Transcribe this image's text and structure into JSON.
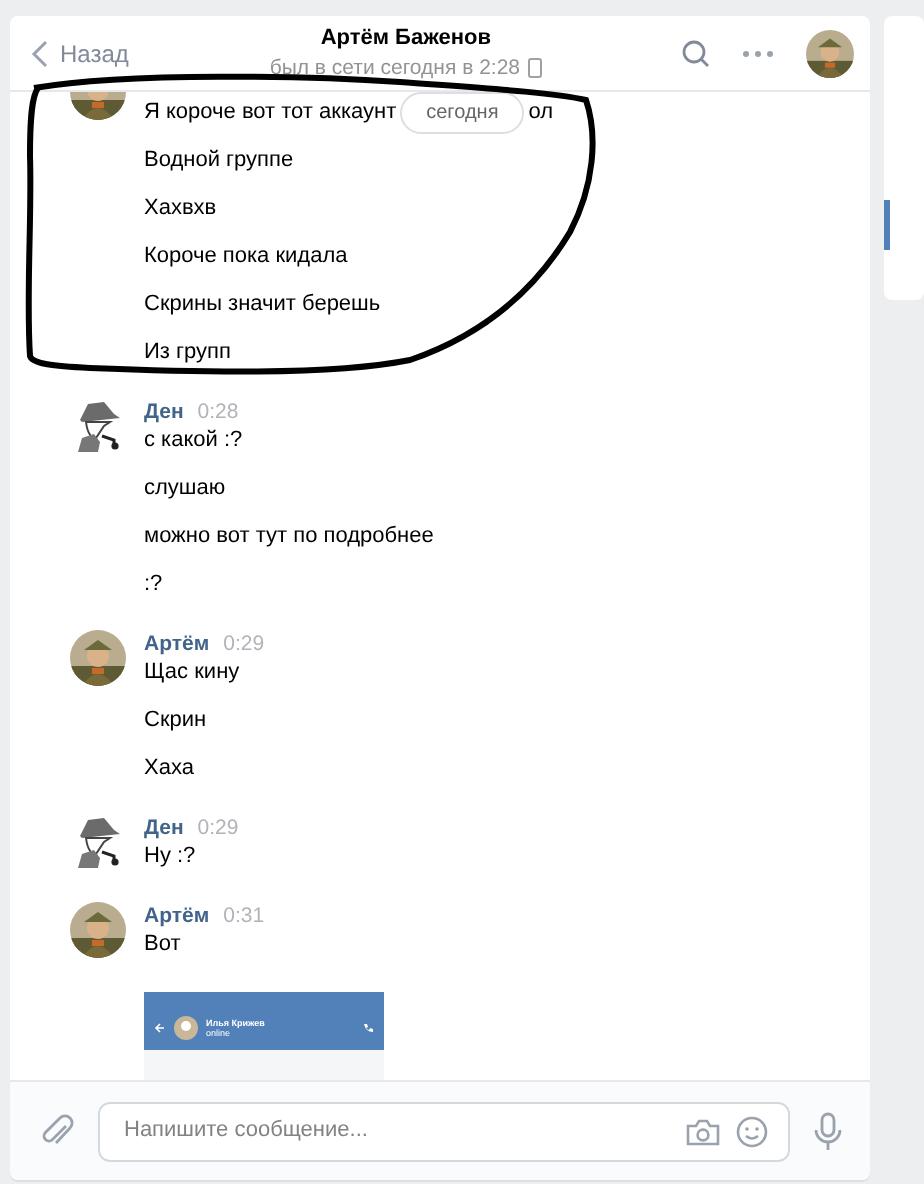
{
  "header": {
    "back": "Назад",
    "title": "Артём Баженов",
    "status": "был в сети сегодня в 2:28"
  },
  "date_badge": "сегодня",
  "groups": [
    {
      "avatar": {
        "kind": "soldier"
      },
      "messages": [
        {
          "text": "Я короче вот тот аккаунт",
          "tail": "ол"
        },
        {
          "text": "Водной группе"
        },
        {
          "text": "Хахвхв"
        },
        {
          "text": "Короче пока кидала"
        },
        {
          "text": "Скрины значит берешь"
        },
        {
          "text": "Из групп"
        }
      ]
    },
    {
      "avatar": {
        "kind": "detective"
      },
      "author": "Ден",
      "time": "0:28",
      "messages": [
        {
          "text": "с какой :?"
        },
        {
          "text": "слушаю"
        },
        {
          "text": "можно вот тут по подробнее"
        },
        {
          "text": ":?"
        }
      ]
    },
    {
      "avatar": {
        "kind": "soldier"
      },
      "author": "Артём",
      "time": "0:29",
      "messages": [
        {
          "text": "Щас кину"
        },
        {
          "text": "Скрин"
        },
        {
          "text": "Хаха"
        }
      ]
    },
    {
      "avatar": {
        "kind": "detective"
      },
      "author": "Ден",
      "time": "0:29",
      "messages": [
        {
          "text": "Ну :?"
        }
      ]
    },
    {
      "avatar": {
        "kind": "soldier"
      },
      "author": "Артём",
      "time": "0:31",
      "messages": [
        {
          "text": "Вот"
        }
      ],
      "attachment": {
        "kind": "screenshot",
        "name": "Илья Крижев",
        "status": "online"
      }
    }
  ],
  "composer": {
    "placeholder": "Напишите сообщение..."
  }
}
